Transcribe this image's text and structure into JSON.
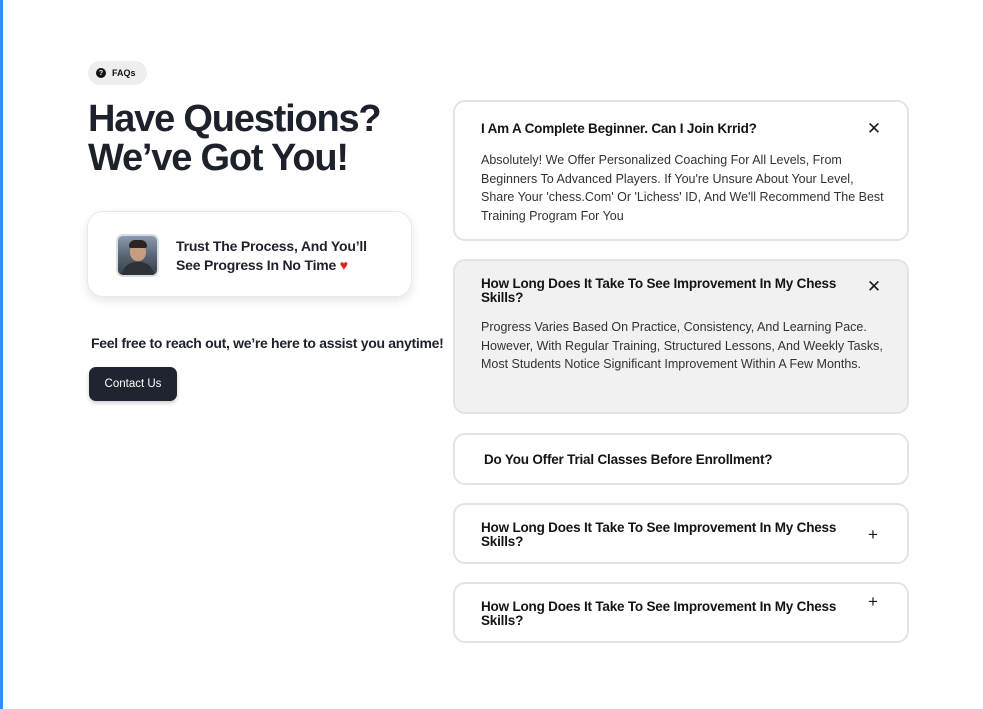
{
  "badge": {
    "label": "FAQs",
    "icon": "question-icon"
  },
  "headline": {
    "line1": "Have Questions?",
    "line2": "We’ve Got You!"
  },
  "trust_card": {
    "line1": "Trust The Process, And You’ll",
    "line2": "See Progress In No Time",
    "heart": "♥"
  },
  "reach_out": "Feel free to reach out, we’re here to assist you anytime!",
  "contact_button": "Contact Us",
  "faqs": [
    {
      "question": "I Am A Complete Beginner. Can I Join Krrid?",
      "answer": "Absolutely! We Offer Personalized Coaching For All Levels, From Beginners To Advanced Players. If You're Unsure About Your Level, Share Your 'chess.Com' Or 'Lichess' ID, And We'll Recommend The Best Training Program For You",
      "toggle": "✕",
      "state": "open"
    },
    {
      "question": "How Long Does It Take To See Improvement In My Chess Skills?",
      "answer": "Progress Varies Based On Practice, Consistency, And Learning Pace. However, With Regular Training, Structured Lessons, And Weekly Tasks, Most Students Notice Significant Improvement Within A Few Months.",
      "toggle": "✕",
      "state": "open-highlighted"
    },
    {
      "question": "Do You Offer Trial Classes Before Enrollment?",
      "toggle": "",
      "state": "closed"
    },
    {
      "question": "How Long Does It Take To See Improvement In My Chess Skills?",
      "toggle": "+",
      "state": "closed"
    },
    {
      "question": "How Long Does It Take To See Improvement In My Chess Skills?",
      "toggle": "+",
      "state": "closed"
    }
  ],
  "colors": {
    "accent_dark": "#1f2430",
    "heart": "#e0201b",
    "highlight_bg": "#f1f1f1",
    "left_edge": "#2f8ff0"
  }
}
